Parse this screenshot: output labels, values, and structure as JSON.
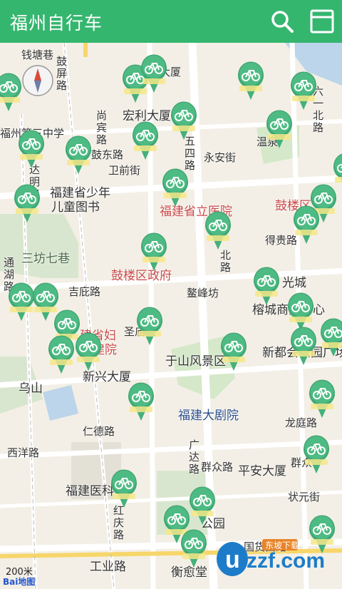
{
  "app": {
    "title": "福州自行车"
  },
  "toolbar": {
    "search_icon": "search-icon",
    "list_icon": "list-icon"
  },
  "colors": {
    "brand": "#35b66f",
    "marker": "#45b07a"
  },
  "map": {
    "labels": {
      "qianzhanghang": "钱塘巷",
      "gupinglu": "鼓屏路",
      "dasha": "大厦",
      "hongli": "宏利大厦",
      "fuzhou_school": "福州第三中学",
      "shangbin": "尚宾路",
      "gudonglu": "鼓东路",
      "weiqianjie": "卫前街",
      "wusilu": "五四路",
      "yongangjie": "永安街",
      "wenquan": "温泉",
      "liuyibei": "六一北路",
      "dalu": "达明路",
      "library1": "福建省少年",
      "library2": "儿童图书",
      "hospital_prov": "福建省立医院",
      "gulou_cap": "鼓楼区",
      "sanfang": "三坊七巷",
      "degui": "得贵路",
      "gulou_gov": "鼓楼区政府",
      "beilu": "北路",
      "tonghu": "通湖路",
      "jizhuang": "吉庇路",
      "aofeng": "鳌峰坊",
      "guangcheng": "光城",
      "rongcheng": "榕城商贸中心",
      "fujian_fu": "建省妇",
      "fujian_fu2": "建院",
      "shenglu": "圣庙路",
      "yushan": "于山风景区",
      "xindu": "新都会公园广场",
      "wushan": "乌山",
      "xinxing": "新兴大厦",
      "juyuan": "福建大剧院",
      "longtinglu": "龙庭路",
      "renbelu": "仁德路",
      "xiyanglu": "西洋路",
      "guangdalu": "广达路",
      "qunzhonglu": "群众路",
      "pingan": "平安大厦",
      "qunzhong2": "群众",
      "fujianyike": "福建医科",
      "zhuangyuan": "状元街",
      "hongqing": "红庆路",
      "gongyelu": "工业路",
      "hengyutang": "衡愈堂",
      "gonghuaxi": "国货西路",
      "gongyuan": "公园"
    },
    "scale": "200米",
    "logo": "Bai地图",
    "watermark": "uzzf.com",
    "watermark_sub": "东坡下载"
  }
}
